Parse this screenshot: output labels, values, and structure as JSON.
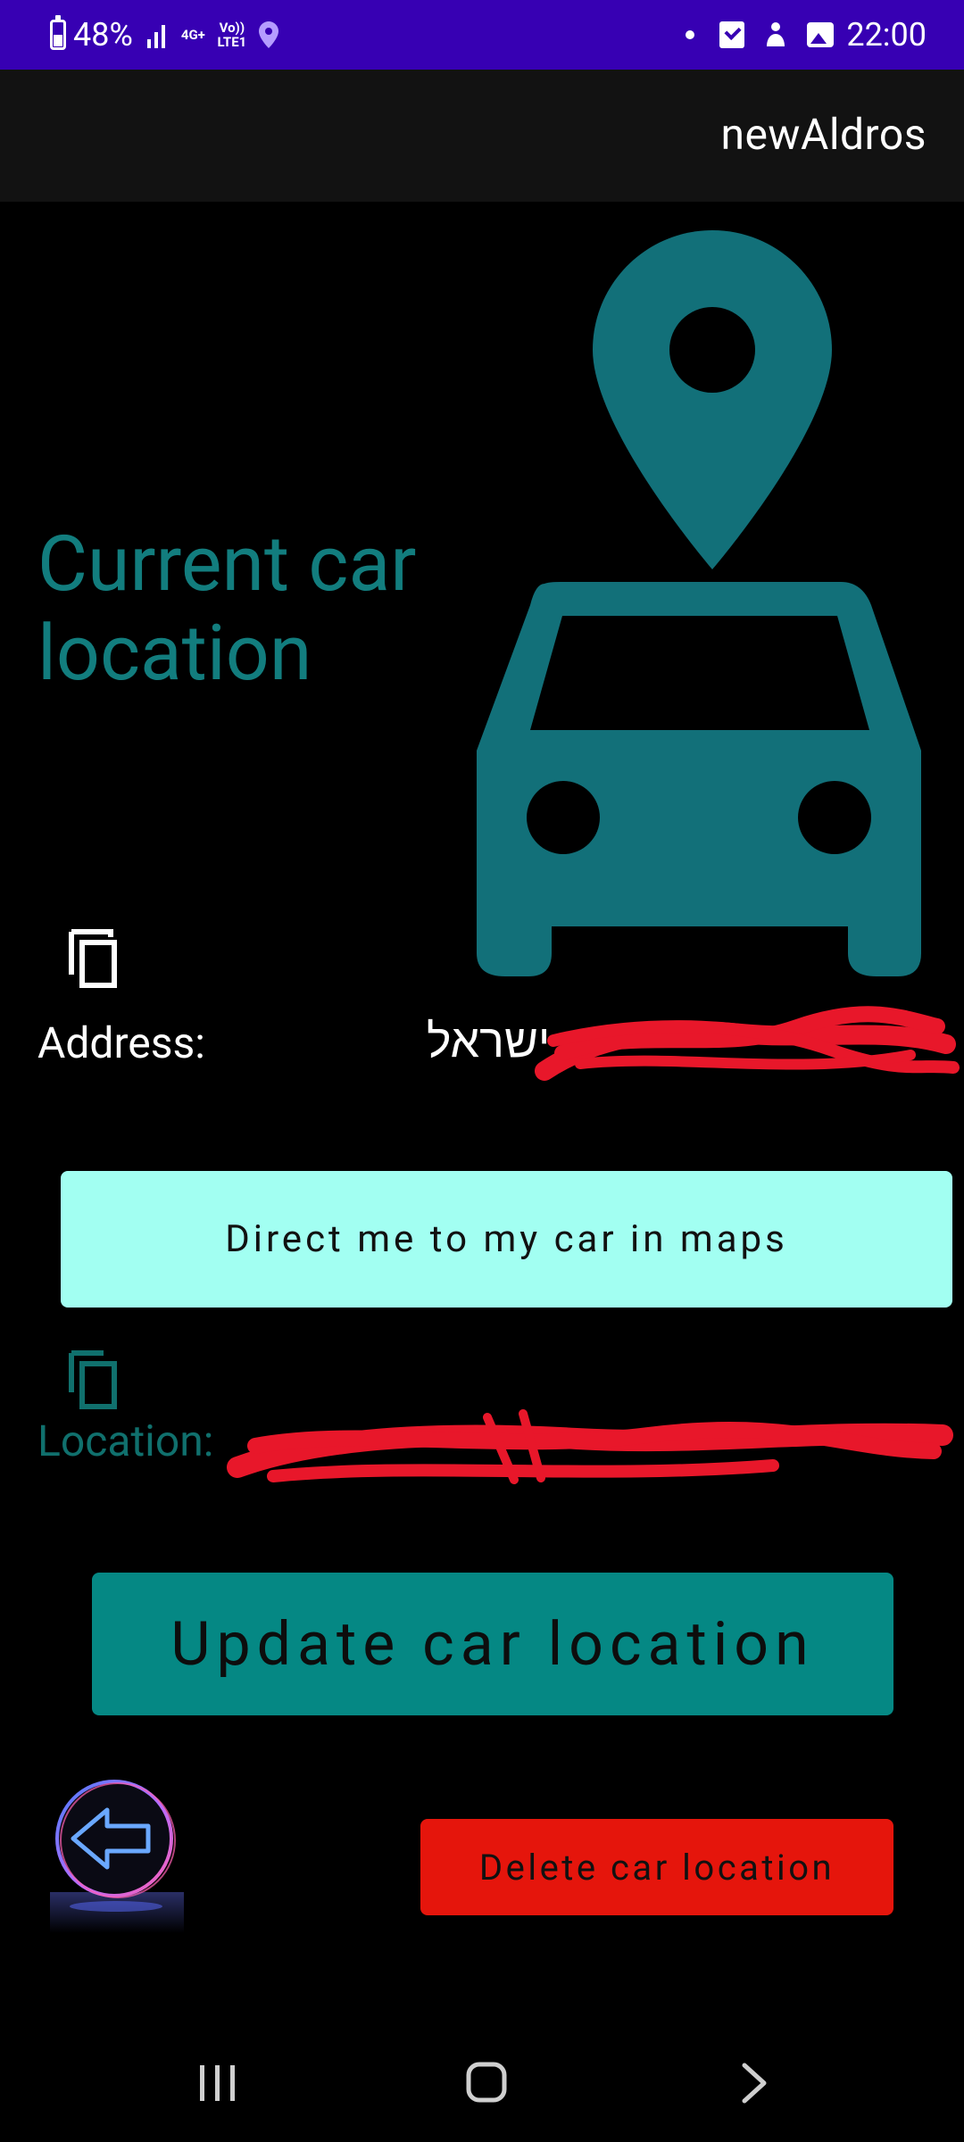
{
  "status_bar": {
    "battery": "48%",
    "network_top": "4G+",
    "network_bottom": "Vo)) LTE1",
    "time": "22:00"
  },
  "app_bar": {
    "title": "newAldros"
  },
  "main": {
    "heading": "Current car location",
    "hero_icon": "car-location-pin-icon",
    "accent_color": "#127d7e",
    "address_label": "Address:",
    "address_value": "ישראל",
    "direct_button_label": "Direct me to my car in maps",
    "location_label": "Location:",
    "update_button_label": "Update car location",
    "delete_button_label": "Delete car location"
  },
  "colors": {
    "status_bar": "#3700B3",
    "app_bar": "#121212",
    "direct_button": "#a2fff2",
    "update_button": "#058884",
    "delete_button": "#e5150c"
  }
}
